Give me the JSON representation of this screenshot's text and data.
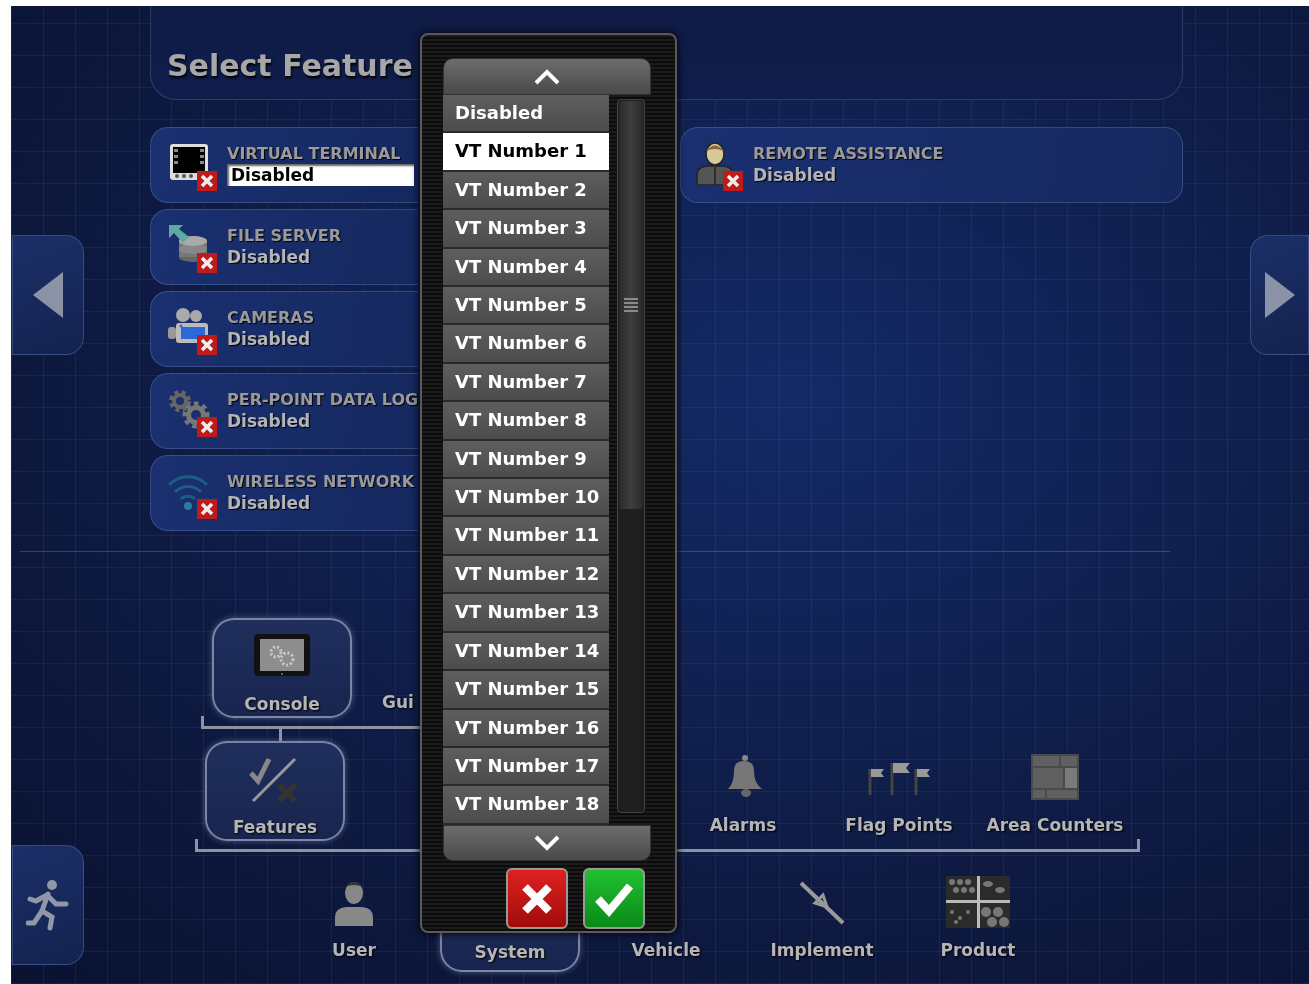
{
  "header": {
    "title": "Select Feature"
  },
  "features": {
    "left": [
      {
        "name": "VIRTUAL TERMINAL",
        "value": "Disabled",
        "kind": "terminal",
        "enabled": false,
        "selected": true
      },
      {
        "name": "FILE SERVER",
        "value": "Disabled",
        "kind": "file-server",
        "enabled": false,
        "selected": false
      },
      {
        "name": "CAMERAS",
        "value": "Disabled",
        "kind": "cameras",
        "enabled": false,
        "selected": false
      },
      {
        "name": "PER-POINT DATA LOG",
        "value": "Disabled",
        "kind": "gears",
        "enabled": false,
        "selected": false
      },
      {
        "name": "WIRELESS NETWORK",
        "value": "Disabled",
        "kind": "wireless",
        "enabled": false,
        "selected": false
      }
    ],
    "right": [
      {
        "name": "REMOTE ASSISTANCE",
        "value": "Disabled",
        "kind": "person",
        "enabled": false,
        "selected": false
      }
    ]
  },
  "navigation": {
    "row_1": [
      {
        "label": "Console",
        "kind": "console",
        "selected": true
      },
      {
        "label": "Gui",
        "kind": "guidance",
        "selected": false
      }
    ],
    "row_2": [
      {
        "label": "Features",
        "kind": "features",
        "selected": true
      },
      {
        "label": "Alarms",
        "kind": "alarms",
        "selected": false
      },
      {
        "label": "Flag Points",
        "kind": "flags",
        "selected": false
      },
      {
        "label": "Area Counters",
        "kind": "area",
        "selected": false
      }
    ],
    "row_3": [
      {
        "label": "User",
        "kind": "user",
        "selected": false
      },
      {
        "label": "System",
        "kind": "system",
        "selected": true
      },
      {
        "label": "Vehicle",
        "kind": "vehicle",
        "selected": false
      },
      {
        "label": "Implement",
        "kind": "implement",
        "selected": false
      },
      {
        "label": "Product",
        "kind": "product",
        "selected": false
      }
    ]
  },
  "dropdown": {
    "items": [
      {
        "label": "Disabled",
        "selected": false
      },
      {
        "label": "VT Number 1",
        "selected": true
      },
      {
        "label": "VT Number 2",
        "selected": false
      },
      {
        "label": "VT Number 3",
        "selected": false
      },
      {
        "label": "VT Number 4",
        "selected": false
      },
      {
        "label": "VT Number 5",
        "selected": false
      },
      {
        "label": "VT Number 6",
        "selected": false
      },
      {
        "label": "VT Number 7",
        "selected": false
      },
      {
        "label": "VT Number 8",
        "selected": false
      },
      {
        "label": "VT Number 9",
        "selected": false
      },
      {
        "label": "VT Number 10",
        "selected": false
      },
      {
        "label": "VT Number 11",
        "selected": false
      },
      {
        "label": "VT Number 12",
        "selected": false
      },
      {
        "label": "VT Number 13",
        "selected": false
      },
      {
        "label": "VT Number 14",
        "selected": false
      },
      {
        "label": "VT Number 15",
        "selected": false
      },
      {
        "label": "VT Number 16",
        "selected": false
      },
      {
        "label": "VT Number 17",
        "selected": false
      },
      {
        "label": "VT Number 18",
        "selected": false
      }
    ]
  }
}
